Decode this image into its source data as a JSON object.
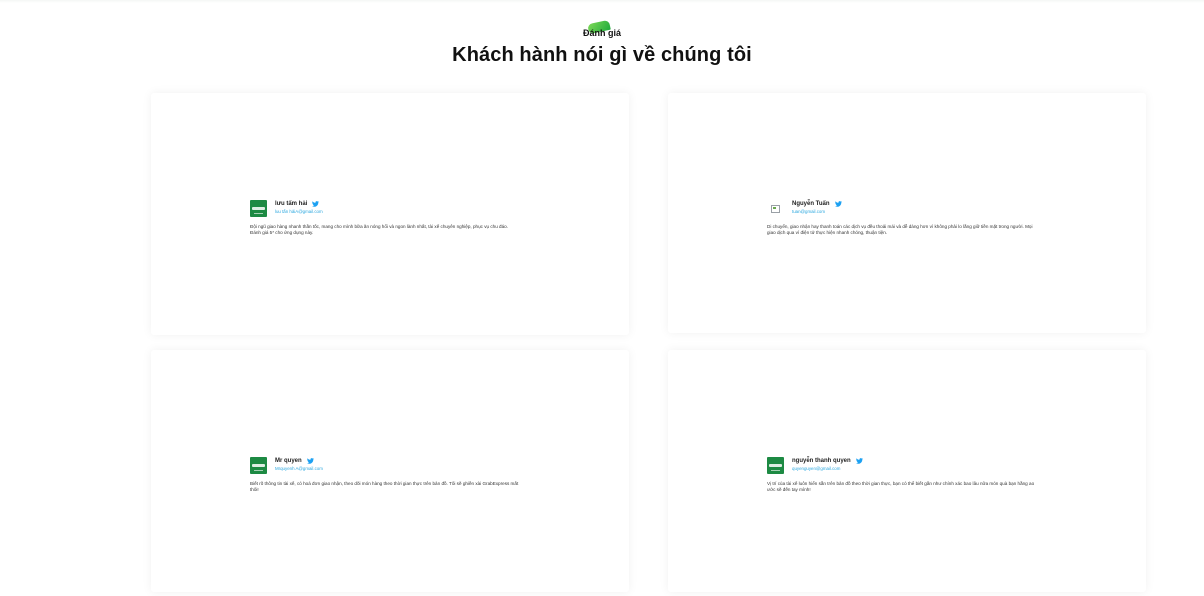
{
  "section": {
    "tag": "Đánh giá",
    "title": "Khách hành nói gì về chúng tôi"
  },
  "reviews": [
    {
      "name": "lưu tấm hải",
      "email": "luu tấn hảiA@gmail.com",
      "text": "Đội ngũ giao hàng nhanh thần tốc, mang cho mình bữa ăn nóng hổi và ngon lành nhất, tài xế chuyên nghiệp, phục vụ chu đáo. Đánh giá 5* cho ứng dụng này.",
      "avatar_icon": "brand-logo-icon"
    },
    {
      "name": "Nguyễn Tuấn",
      "email": "tuan@gmail.com",
      "text": "Di chuyển, giao nhận hay thanh toán các dịch vụ đều thoải mái và dễ dàng hơn vì không phải lo lắng giữ tiền mặt trong người. Mọi giao dịch qua ví điện tử thực hiện nhanh chóng, thuận tiện.",
      "avatar_icon": "broken-image-icon"
    },
    {
      "name": "Mr quyen",
      "email": "Mrquyenh A@gmail.com",
      "text": "Biết rõ thông tin tài xế, có hoá đơn giao nhận, theo dõi món hàng theo thời gian thực trên bản đồ. Tôi sẽ ghiền xài GrabExpress mất thôi!",
      "avatar_icon": "brand-logo-icon"
    },
    {
      "name": "nguyễn thanh quyen",
      "email": "quyenguyen@gmail.com",
      "text": "Vị trí của tài xế luôn hiển sẵn trên bản đồ theo thời gian thực, bạn có thể biết gần như chính xác bao lâu nữa món quà bạn hằng ao ước sẽ đến tay mình!",
      "avatar_icon": "brand-logo-icon"
    }
  ],
  "colors": {
    "accent_green": "#1faa3b",
    "twitter_blue": "#1da1f2",
    "email_blue": "#2aa7df"
  }
}
